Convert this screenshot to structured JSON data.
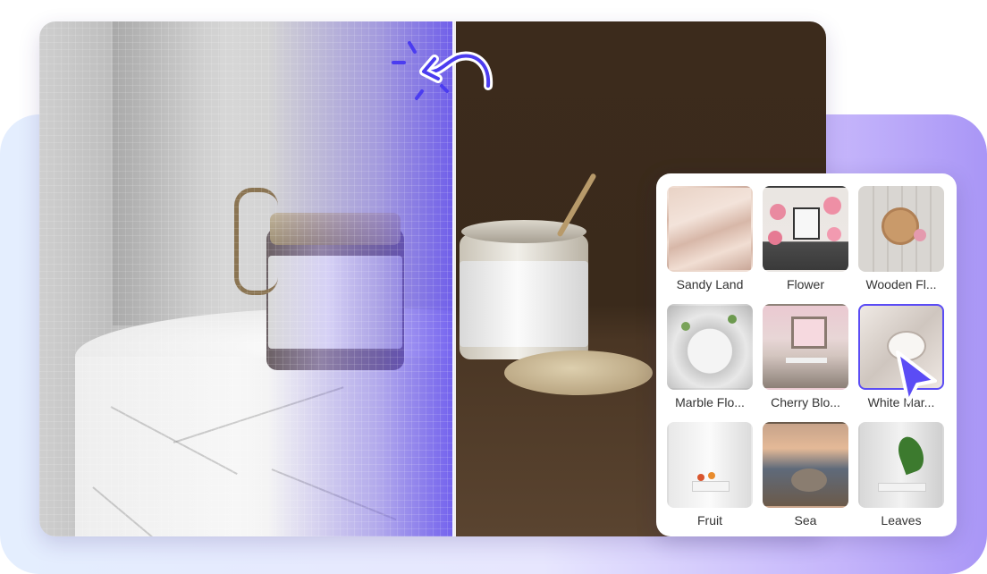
{
  "panel": {
    "backgrounds": [
      {
        "label": "Sandy Land",
        "selected": false
      },
      {
        "label": "Flower",
        "selected": false
      },
      {
        "label": "Wooden Fl...",
        "selected": false
      },
      {
        "label": "Marble Flo...",
        "selected": false
      },
      {
        "label": "Cherry Blo...",
        "selected": false
      },
      {
        "label": "White Mar...",
        "selected": true
      },
      {
        "label": "Fruit",
        "selected": false
      },
      {
        "label": "Sea",
        "selected": false
      },
      {
        "label": "Leaves",
        "selected": false
      }
    ]
  },
  "colors": {
    "accent": "#5b4cf5",
    "scan_overlay": "#6e5af0",
    "right_background": "#3c2b1c"
  },
  "icons": {
    "swap": "swap-arrow-icon",
    "cursor": "mouse-pointer-icon"
  }
}
